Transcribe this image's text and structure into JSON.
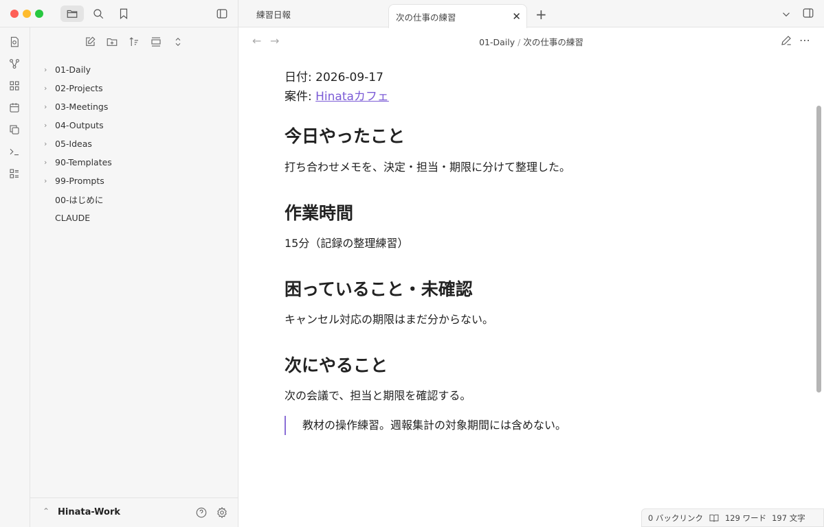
{
  "tabs": [
    {
      "label": "練習日報",
      "active": false
    },
    {
      "label": "次の仕事の練習",
      "active": true
    }
  ],
  "breadcrumb": {
    "folder": "01-Daily",
    "separator": "/",
    "note": "次の仕事の練習"
  },
  "explorer": {
    "items": [
      {
        "label": "01-Daily",
        "type": "folder"
      },
      {
        "label": "02-Projects",
        "type": "folder"
      },
      {
        "label": "03-Meetings",
        "type": "folder"
      },
      {
        "label": "04-Outputs",
        "type": "folder"
      },
      {
        "label": "05-Ideas",
        "type": "folder"
      },
      {
        "label": "90-Templates",
        "type": "folder"
      },
      {
        "label": "99-Prompts",
        "type": "folder"
      },
      {
        "label": "00-はじめに",
        "type": "file"
      },
      {
        "label": "CLAUDE",
        "type": "file"
      }
    ],
    "vault_name": "Hinata-Work"
  },
  "note": {
    "date_label": "日付: ",
    "date_value": "2026-09-17",
    "project_label": "案件: ",
    "project_link": "Hinataカフェ",
    "sections": [
      {
        "heading": "今日やったこと",
        "body": "打ち合わせメモを、決定・担当・期限に分けて整理した。"
      },
      {
        "heading": "作業時間",
        "body": "15分（記録の整理練習）"
      },
      {
        "heading": "困っていること・未確認",
        "body": "キャンセル対応の期限はまだ分からない。"
      },
      {
        "heading": "次にやること",
        "body": "次の会議で、担当と期限を確認する。"
      }
    ],
    "quote": "教材の操作練習。週報集計の対象期間には含めない。"
  },
  "status": {
    "backlinks": "0 バックリンク",
    "words": "129 ワード",
    "chars": "197 文字"
  },
  "colors": {
    "accent": "#7b5bd6",
    "sidebar_bg": "#f6f6f6",
    "close": "#fe5f57",
    "minimize": "#febc2e",
    "zoom": "#28c840"
  }
}
